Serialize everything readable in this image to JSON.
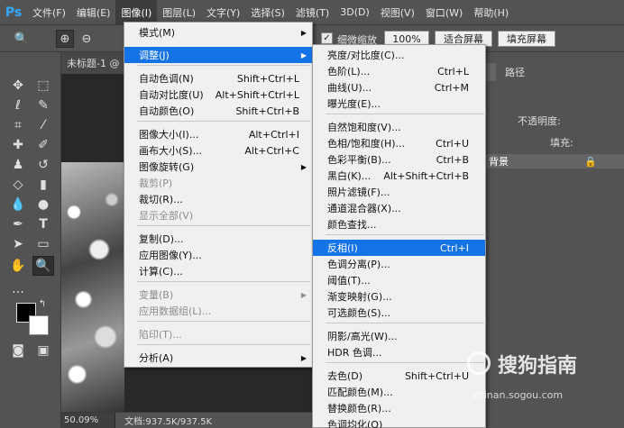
{
  "app": {
    "logo": "Ps"
  },
  "menubar": {
    "items": [
      "文件(F)",
      "编辑(E)",
      "图像(I)",
      "图层(L)",
      "文字(Y)",
      "选择(S)",
      "滤镜(T)",
      "3D(D)",
      "视图(V)",
      "窗口(W)",
      "帮助(H)"
    ]
  },
  "options": {
    "fine_zoom": "细微缩放",
    "zoom_100": "100%",
    "fit_screen": "适合屏幕",
    "fill_screen": "填充屏幕"
  },
  "document": {
    "tab_title": "未标题-1 @",
    "zoom": "50.09%",
    "doc_size": "文档:937.5K/937.5K"
  },
  "right_panel": {
    "tab_paths": "路径",
    "opacity_label": "不透明度:",
    "fill_label": "填充:",
    "layer_name": "背景"
  },
  "image_menu": {
    "items": [
      {
        "label": "模式(M)",
        "shortcut": "",
        "submenu": true,
        "disabled": false
      },
      {
        "label": "调整(J)",
        "shortcut": "",
        "submenu": true,
        "disabled": false,
        "highlighted": true
      },
      {
        "label": "自动色调(N)",
        "shortcut": "Shift+Ctrl+L",
        "disabled": false
      },
      {
        "label": "自动对比度(U)",
        "shortcut": "Alt+Shift+Ctrl+L",
        "disabled": false
      },
      {
        "label": "自动颜色(O)",
        "shortcut": "Shift+Ctrl+B",
        "disabled": false
      },
      {
        "label": "图像大小(I)...",
        "shortcut": "Alt+Ctrl+I",
        "disabled": false
      },
      {
        "label": "画布大小(S)...",
        "shortcut": "Alt+Ctrl+C",
        "disabled": false
      },
      {
        "label": "图像旋转(G)",
        "shortcut": "",
        "submenu": true,
        "disabled": false
      },
      {
        "label": "裁剪(P)",
        "shortcut": "",
        "disabled": true
      },
      {
        "label": "裁切(R)...",
        "shortcut": "",
        "disabled": false
      },
      {
        "label": "显示全部(V)",
        "shortcut": "",
        "disabled": true
      },
      {
        "label": "复制(D)...",
        "shortcut": "",
        "disabled": false
      },
      {
        "label": "应用图像(Y)...",
        "shortcut": "",
        "disabled": false
      },
      {
        "label": "计算(C)...",
        "shortcut": "",
        "disabled": false
      },
      {
        "label": "变量(B)",
        "shortcut": "",
        "submenu": true,
        "disabled": true
      },
      {
        "label": "应用数据组(L)...",
        "shortcut": "",
        "disabled": true
      },
      {
        "label": "陷印(T)...",
        "shortcut": "",
        "disabled": true
      },
      {
        "label": "分析(A)",
        "shortcut": "",
        "submenu": true,
        "disabled": false
      }
    ]
  },
  "adjust_menu": {
    "items": [
      {
        "label": "亮度/对比度(C)...",
        "shortcut": ""
      },
      {
        "label": "色阶(L)...",
        "shortcut": "Ctrl+L"
      },
      {
        "label": "曲线(U)...",
        "shortcut": "Ctrl+M"
      },
      {
        "label": "曝光度(E)...",
        "shortcut": ""
      },
      {
        "label": "自然饱和度(V)...",
        "shortcut": ""
      },
      {
        "label": "色相/饱和度(H)...",
        "shortcut": "Ctrl+U"
      },
      {
        "label": "色彩平衡(B)...",
        "shortcut": "Ctrl+B"
      },
      {
        "label": "黑白(K)...",
        "shortcut": "Alt+Shift+Ctrl+B"
      },
      {
        "label": "照片滤镜(F)...",
        "shortcut": ""
      },
      {
        "label": "通道混合器(X)...",
        "shortcut": ""
      },
      {
        "label": "颜色查找...",
        "shortcut": ""
      },
      {
        "label": "反相(I)",
        "shortcut": "Ctrl+I",
        "highlighted": true
      },
      {
        "label": "色调分离(P)...",
        "shortcut": ""
      },
      {
        "label": "阈值(T)...",
        "shortcut": ""
      },
      {
        "label": "渐变映射(G)...",
        "shortcut": ""
      },
      {
        "label": "可选颜色(S)...",
        "shortcut": ""
      },
      {
        "label": "阴影/高光(W)...",
        "shortcut": ""
      },
      {
        "label": "HDR 色调...",
        "shortcut": ""
      },
      {
        "label": "去色(D)",
        "shortcut": "Shift+Ctrl+U"
      },
      {
        "label": "匹配颜色(M)...",
        "shortcut": ""
      },
      {
        "label": "替换颜色(R)...",
        "shortcut": ""
      },
      {
        "label": "色调均化(Q)",
        "shortcut": ""
      }
    ]
  },
  "watermark": {
    "text": "搜狗指南",
    "url": "zhinan.sogou.com"
  },
  "colors": {
    "highlight": "#1473e6",
    "menu_bg": "#f0f0f0",
    "ui_bg": "#535353"
  }
}
